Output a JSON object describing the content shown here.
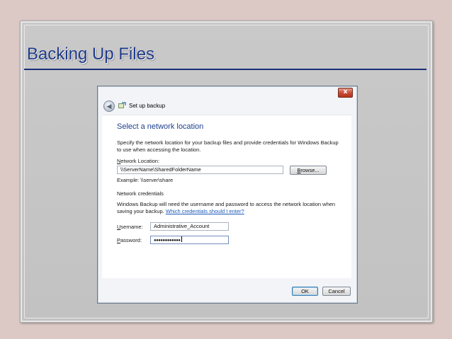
{
  "slide": {
    "title": "Backing Up Files"
  },
  "window": {
    "title": "Set up backup",
    "close_glyph": "x",
    "back_glyph": "◀"
  },
  "page": {
    "heading": "Select a network location",
    "description": "Specify the network location for your backup files and provide credentials for Windows Backup to use when accessing the location.",
    "network_location": {
      "label_prefix": "N",
      "label_rest": "etwork Location:",
      "value": "\\\\ServerName\\SharedFolderName",
      "example": "Example: \\\\server\\share"
    },
    "browse_button": {
      "label_prefix": "B",
      "label_rest": "rowse..."
    },
    "credentials": {
      "heading": "Network credentials",
      "description_text": "Windows Backup will need the username and password to access the network location when saving your backup. ",
      "help_link": "Which credentials should I enter?"
    },
    "username": {
      "label_prefix": "U",
      "label_rest": "sername:",
      "value": "Administrative_Account"
    },
    "password": {
      "label_prefix": "P",
      "label_rest": "assword:",
      "value": "●●●●●●●●●●●●"
    }
  },
  "footer": {
    "ok_label": "OK",
    "cancel_label": "Cancel"
  },
  "colors": {
    "slide_title": "#1f3a8a",
    "heading": "#1e3f8f",
    "link": "#1a57b8"
  }
}
